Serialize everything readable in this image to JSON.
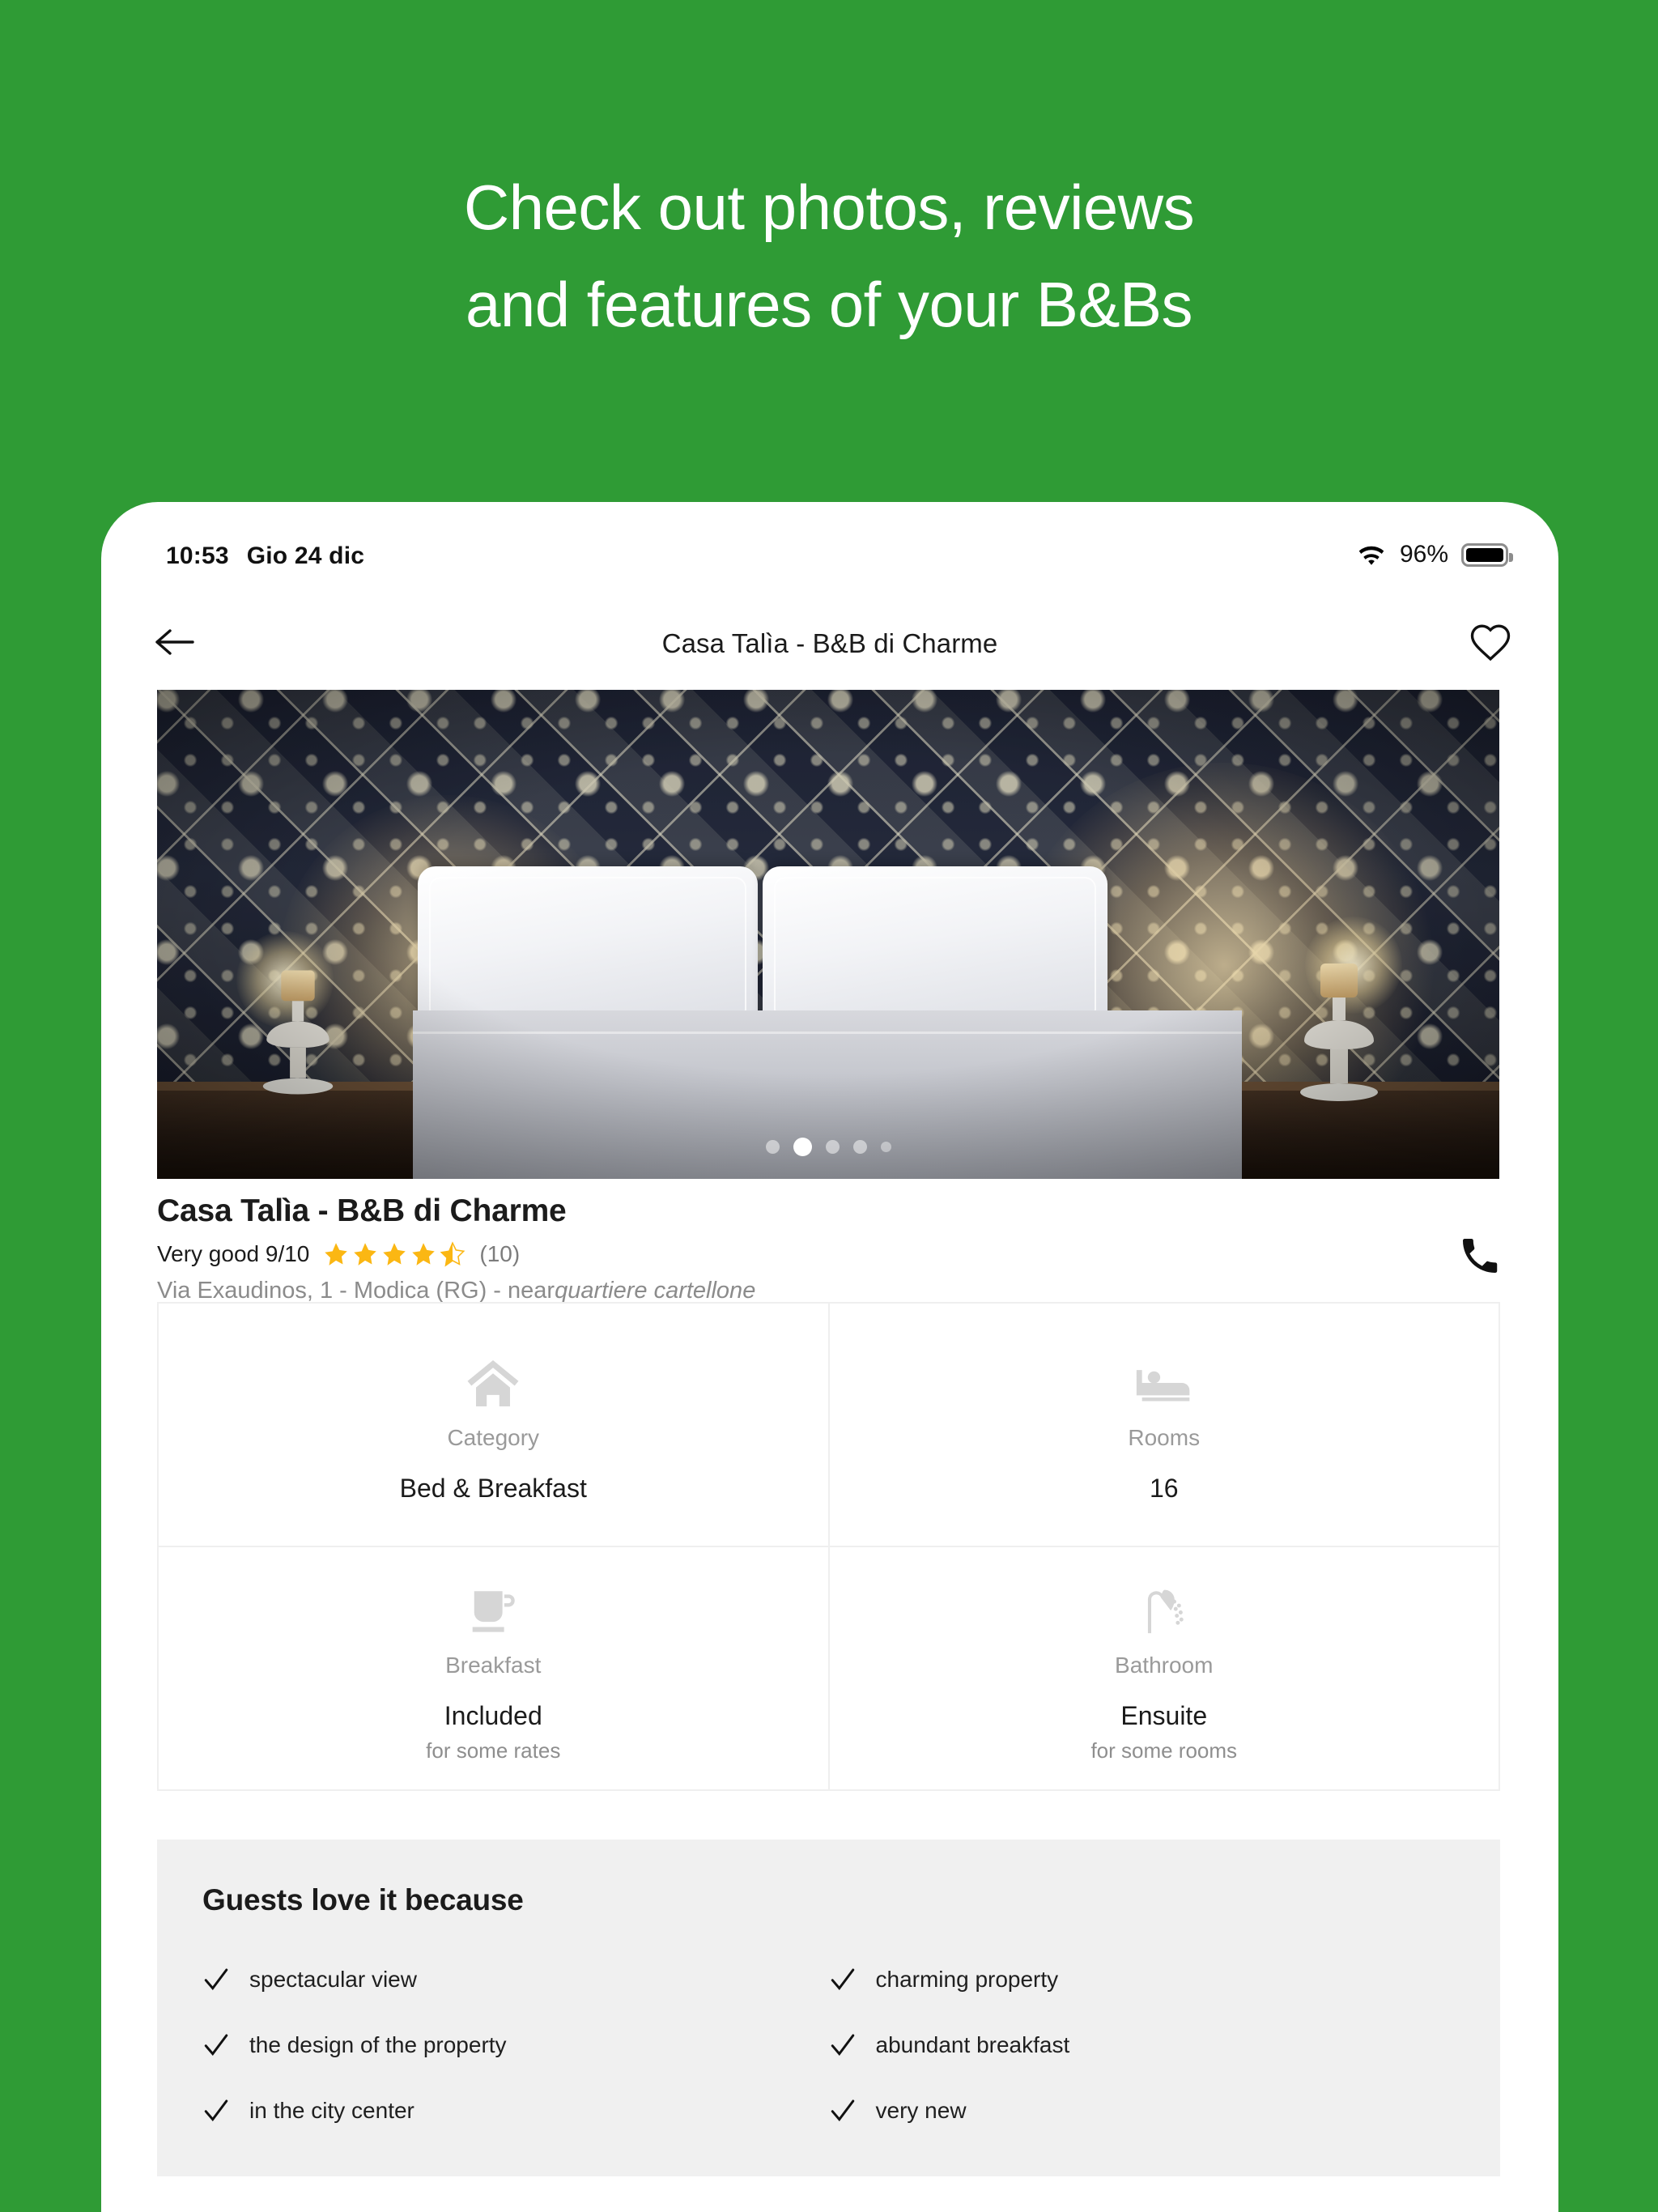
{
  "promo": {
    "line1": "Check out photos, reviews",
    "line2": "and features of your B&Bs",
    "background_color": "#2F9B35",
    "text_color": "#FFFFFF"
  },
  "status_bar": {
    "time": "10:53",
    "date": "Gio 24 dic",
    "battery_percent": "96%",
    "wifi_icon": "wifi-icon",
    "battery_icon": "battery-icon"
  },
  "nav_bar": {
    "back_icon": "arrow-left-icon",
    "title": "Casa Talìa - B&B di Charme",
    "favorite_icon": "heart-outline-icon"
  },
  "gallery": {
    "photo_alt": "bedroom with decorative tiled wall",
    "dot_count": 5,
    "active_dot_index": 1
  },
  "property": {
    "name": "Casa Talìa - B&B di Charme",
    "rating_label": "Very good 9/10",
    "stars_filled": 4,
    "stars_half": 1,
    "stars_total": 5,
    "star_color": "#FBB713",
    "review_count": "(10)",
    "address_main": "Via Exaudinos, 1 - Modica (RG) - near",
    "address_area": "quartiere cartellone",
    "phone_icon": "phone-icon"
  },
  "features": [
    {
      "icon": "home-icon",
      "label": "Category",
      "value": "Bed & Breakfast",
      "sub": ""
    },
    {
      "icon": "bed-icon",
      "label": "Rooms",
      "value": "16",
      "sub": ""
    },
    {
      "icon": "coffee-cup-icon",
      "label": "Breakfast",
      "value": "Included",
      "sub": "for some rates"
    },
    {
      "icon": "shower-icon",
      "label": "Bathroom",
      "value": "Ensuite",
      "sub": "for some rooms"
    }
  ],
  "guests_love": {
    "title": "Guests love it because",
    "check_icon": "check-icon",
    "items": [
      "spectacular view",
      "charming property",
      "the design of the property",
      "abundant breakfast",
      "in the city center",
      "very new"
    ]
  }
}
